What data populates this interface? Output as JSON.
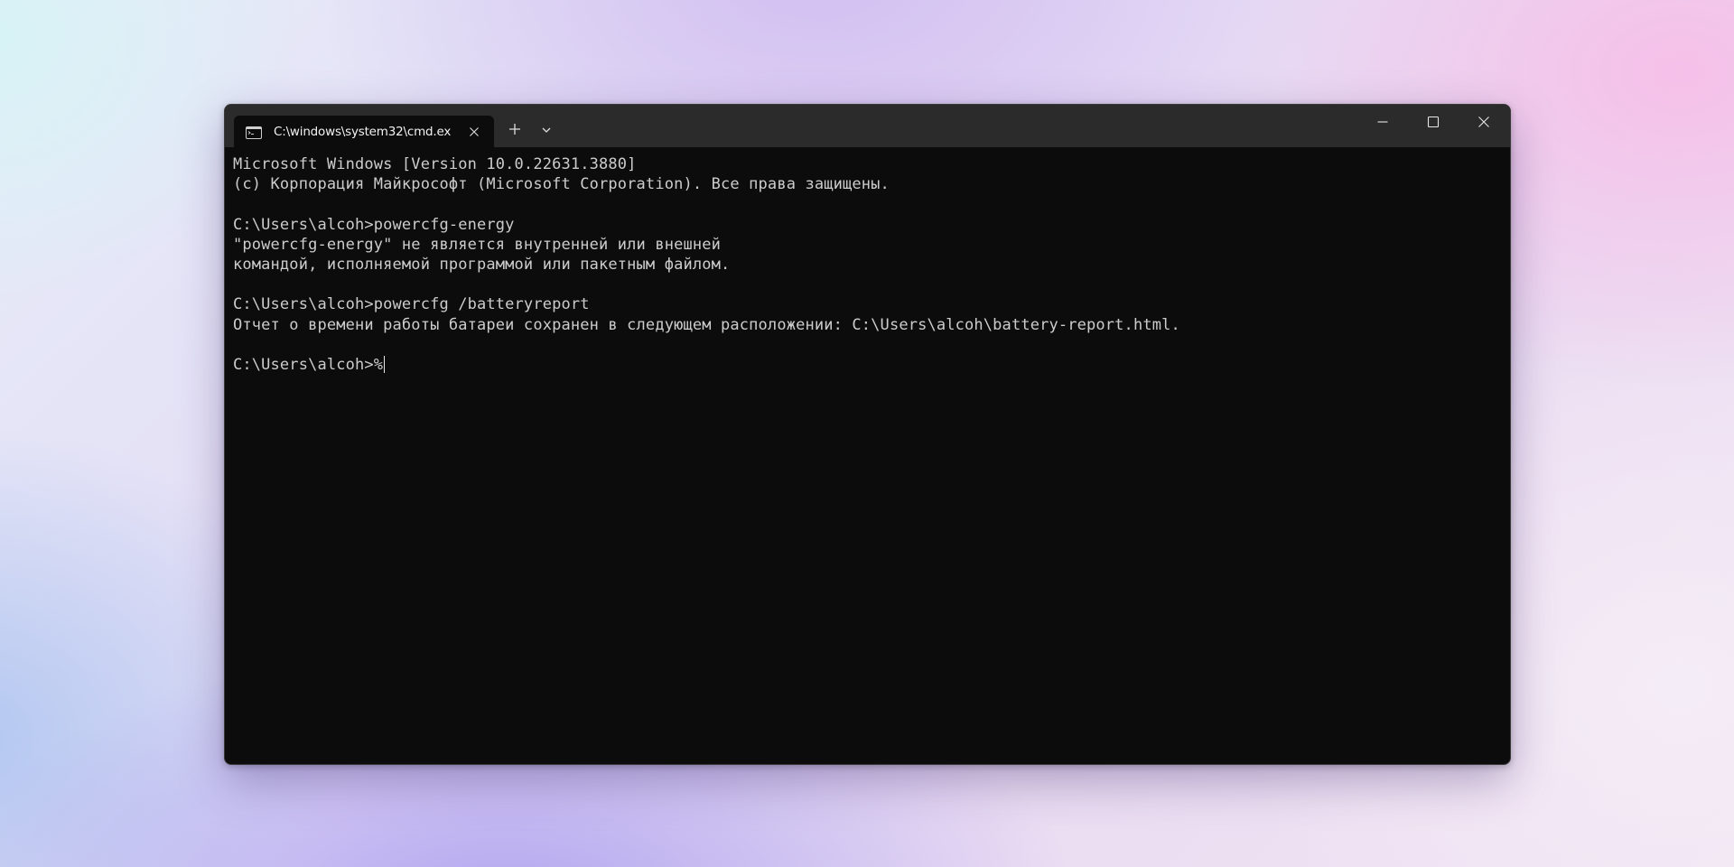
{
  "window": {
    "tab_title": "C:\\windows\\system32\\cmd.ex",
    "icons": {
      "tab": "terminal-icon",
      "tab_close": "close-icon",
      "new_tab": "plus-icon",
      "dropdown": "chevron-down-icon",
      "minimize": "minimize-icon",
      "maximize": "maximize-icon",
      "close": "close-icon"
    }
  },
  "console": {
    "lines": [
      "Microsoft Windows [Version 10.0.22631.3880]",
      "(c) Корпорация Майкрософт (Microsoft Corporation). Все права защищены.",
      "",
      "C:\\Users\\alcoh>powercfg-energy",
      "\"powercfg-energy\" не является внутренней или внешней",
      "командой, исполняемой программой или пакетным файлом.",
      "",
      "C:\\Users\\alcoh>powercfg /batteryreport",
      "Отчет о времени работы батареи сохранен в следующем расположении: C:\\Users\\alcoh\\battery-report.html.",
      ""
    ],
    "prompt": "C:\\Users\\alcoh>",
    "input": "%"
  },
  "colors": {
    "console_bg": "#0c0c0c",
    "titlebar_bg": "#2b2b2b",
    "console_text": "#cccccc"
  }
}
